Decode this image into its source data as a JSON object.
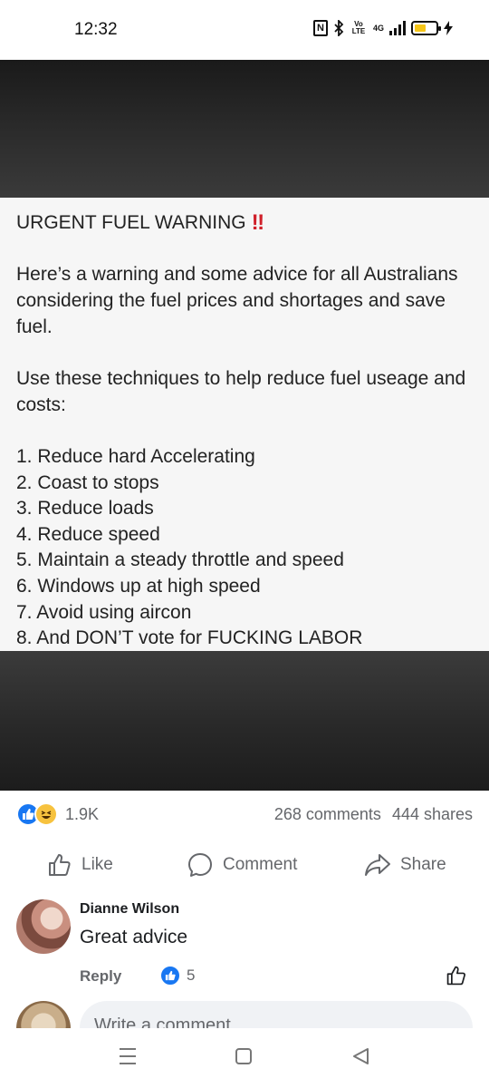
{
  "status_bar": {
    "time": "12:32",
    "nfc_label": "N",
    "volte_label": "Vo LTE",
    "network_label": "4G",
    "battery_level": 0.55
  },
  "post_image": {
    "title": "URGENT FUEL WARNING",
    "title_emoji": "‼",
    "intro": "Here’s a warning and some advice for all Australians considering the fuel prices and shortages and save fuel.",
    "use_line": "Use these techniques to help reduce fuel useage and costs:",
    "tips": [
      "1. Reduce hard Accelerating",
      "2. Coast to stops",
      "3. Reduce loads",
      "4. Reduce speed",
      "5. Maintain a steady throttle and speed",
      "6. Windows up at high speed",
      "7. Avoid using aircon",
      "8. And DON’T vote for FUCKING LABOR"
    ]
  },
  "reactions": {
    "count": "1.9K",
    "comments": "268 comments",
    "shares": "444 shares",
    "icons": [
      "like-reaction-icon",
      "haha-reaction-icon"
    ]
  },
  "actions": {
    "like": "Like",
    "comment": "Comment",
    "share": "Share"
  },
  "comment": {
    "name": "Dianne Wilson",
    "text": "Great advice",
    "reply": "Reply",
    "likes": "5"
  },
  "composer": {
    "placeholder": "Write a comment..."
  },
  "colors": {
    "brand": "#1877f2",
    "muted": "#65676b",
    "alert": "#d0202a"
  }
}
